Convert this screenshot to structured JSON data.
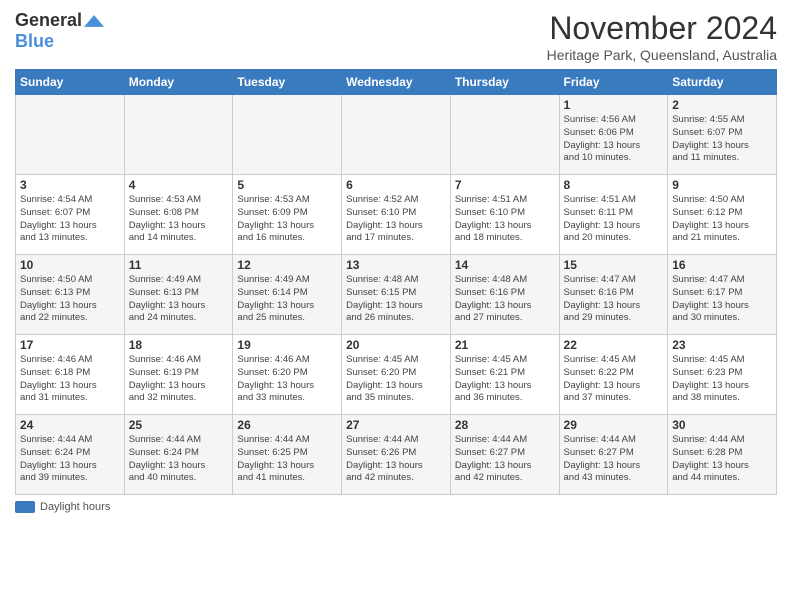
{
  "logo": {
    "general": "General",
    "blue": "Blue"
  },
  "title": "November 2024",
  "location": "Heritage Park, Queensland, Australia",
  "days_of_week": [
    "Sunday",
    "Monday",
    "Tuesday",
    "Wednesday",
    "Thursday",
    "Friday",
    "Saturday"
  ],
  "weeks": [
    [
      {
        "day": "",
        "info": ""
      },
      {
        "day": "",
        "info": ""
      },
      {
        "day": "",
        "info": ""
      },
      {
        "day": "",
        "info": ""
      },
      {
        "day": "",
        "info": ""
      },
      {
        "day": "1",
        "info": "Sunrise: 4:56 AM\nSunset: 6:06 PM\nDaylight: 13 hours\nand 10 minutes."
      },
      {
        "day": "2",
        "info": "Sunrise: 4:55 AM\nSunset: 6:07 PM\nDaylight: 13 hours\nand 11 minutes."
      }
    ],
    [
      {
        "day": "3",
        "info": "Sunrise: 4:54 AM\nSunset: 6:07 PM\nDaylight: 13 hours\nand 13 minutes."
      },
      {
        "day": "4",
        "info": "Sunrise: 4:53 AM\nSunset: 6:08 PM\nDaylight: 13 hours\nand 14 minutes."
      },
      {
        "day": "5",
        "info": "Sunrise: 4:53 AM\nSunset: 6:09 PM\nDaylight: 13 hours\nand 16 minutes."
      },
      {
        "day": "6",
        "info": "Sunrise: 4:52 AM\nSunset: 6:10 PM\nDaylight: 13 hours\nand 17 minutes."
      },
      {
        "day": "7",
        "info": "Sunrise: 4:51 AM\nSunset: 6:10 PM\nDaylight: 13 hours\nand 18 minutes."
      },
      {
        "day": "8",
        "info": "Sunrise: 4:51 AM\nSunset: 6:11 PM\nDaylight: 13 hours\nand 20 minutes."
      },
      {
        "day": "9",
        "info": "Sunrise: 4:50 AM\nSunset: 6:12 PM\nDaylight: 13 hours\nand 21 minutes."
      }
    ],
    [
      {
        "day": "10",
        "info": "Sunrise: 4:50 AM\nSunset: 6:13 PM\nDaylight: 13 hours\nand 22 minutes."
      },
      {
        "day": "11",
        "info": "Sunrise: 4:49 AM\nSunset: 6:13 PM\nDaylight: 13 hours\nand 24 minutes."
      },
      {
        "day": "12",
        "info": "Sunrise: 4:49 AM\nSunset: 6:14 PM\nDaylight: 13 hours\nand 25 minutes."
      },
      {
        "day": "13",
        "info": "Sunrise: 4:48 AM\nSunset: 6:15 PM\nDaylight: 13 hours\nand 26 minutes."
      },
      {
        "day": "14",
        "info": "Sunrise: 4:48 AM\nSunset: 6:16 PM\nDaylight: 13 hours\nand 27 minutes."
      },
      {
        "day": "15",
        "info": "Sunrise: 4:47 AM\nSunset: 6:16 PM\nDaylight: 13 hours\nand 29 minutes."
      },
      {
        "day": "16",
        "info": "Sunrise: 4:47 AM\nSunset: 6:17 PM\nDaylight: 13 hours\nand 30 minutes."
      }
    ],
    [
      {
        "day": "17",
        "info": "Sunrise: 4:46 AM\nSunset: 6:18 PM\nDaylight: 13 hours\nand 31 minutes."
      },
      {
        "day": "18",
        "info": "Sunrise: 4:46 AM\nSunset: 6:19 PM\nDaylight: 13 hours\nand 32 minutes."
      },
      {
        "day": "19",
        "info": "Sunrise: 4:46 AM\nSunset: 6:20 PM\nDaylight: 13 hours\nand 33 minutes."
      },
      {
        "day": "20",
        "info": "Sunrise: 4:45 AM\nSunset: 6:20 PM\nDaylight: 13 hours\nand 35 minutes."
      },
      {
        "day": "21",
        "info": "Sunrise: 4:45 AM\nSunset: 6:21 PM\nDaylight: 13 hours\nand 36 minutes."
      },
      {
        "day": "22",
        "info": "Sunrise: 4:45 AM\nSunset: 6:22 PM\nDaylight: 13 hours\nand 37 minutes."
      },
      {
        "day": "23",
        "info": "Sunrise: 4:45 AM\nSunset: 6:23 PM\nDaylight: 13 hours\nand 38 minutes."
      }
    ],
    [
      {
        "day": "24",
        "info": "Sunrise: 4:44 AM\nSunset: 6:24 PM\nDaylight: 13 hours\nand 39 minutes."
      },
      {
        "day": "25",
        "info": "Sunrise: 4:44 AM\nSunset: 6:24 PM\nDaylight: 13 hours\nand 40 minutes."
      },
      {
        "day": "26",
        "info": "Sunrise: 4:44 AM\nSunset: 6:25 PM\nDaylight: 13 hours\nand 41 minutes."
      },
      {
        "day": "27",
        "info": "Sunrise: 4:44 AM\nSunset: 6:26 PM\nDaylight: 13 hours\nand 42 minutes."
      },
      {
        "day": "28",
        "info": "Sunrise: 4:44 AM\nSunset: 6:27 PM\nDaylight: 13 hours\nand 42 minutes."
      },
      {
        "day": "29",
        "info": "Sunrise: 4:44 AM\nSunset: 6:27 PM\nDaylight: 13 hours\nand 43 minutes."
      },
      {
        "day": "30",
        "info": "Sunrise: 4:44 AM\nSunset: 6:28 PM\nDaylight: 13 hours\nand 44 minutes."
      }
    ]
  ],
  "legend": {
    "label": "Daylight hours"
  },
  "colors": {
    "header_bg": "#3a7abf",
    "header_text": "#ffffff",
    "odd_row": "#f5f5f5",
    "even_row": "#ffffff"
  }
}
